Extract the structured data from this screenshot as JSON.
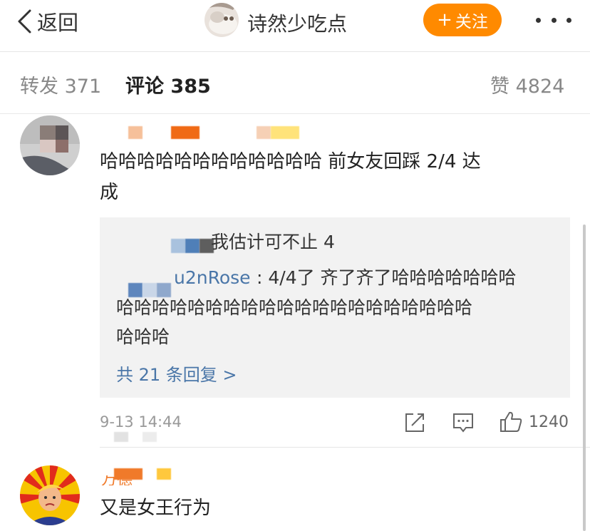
{
  "nav": {
    "back_label": "返回",
    "title": "诗然少吃点",
    "follow_label": "关注",
    "follow_plus": "+"
  },
  "tabs": {
    "repost_label": "转发",
    "repost_count": "371",
    "comment_label": "评论",
    "comment_count": "385",
    "like_label": "赞",
    "like_count": "4824"
  },
  "comments": [
    {
      "text_line1": "哈哈哈哈哈哈哈哈哈哈哈哈 前女友回踩 2/4  达",
      "text_line2": "成",
      "replies": {
        "reply1_text": "我估计可不止 4",
        "reply2_name_fragment": "u2nRose",
        "reply2_line1": ": 4/4了 齐了齐了哈哈哈哈哈哈哈",
        "reply2_line2": "哈哈哈哈哈哈哈哈哈哈哈哈哈哈哈哈哈哈哈哈",
        "reply2_line3": "哈哈哈",
        "more_label": "共 21 条回复 >"
      },
      "time": "9-13 14:44",
      "like_count": "1240"
    },
    {
      "username_fragment": "万德",
      "text": "又是女王行为"
    }
  ],
  "colors": {
    "accent_orange": "#ff8a00",
    "link_blue": "#4a76a8",
    "reply_bg": "#f2f2f2"
  },
  "icons": [
    "chevron-left-icon",
    "more-dots-icon",
    "share-icon",
    "comment-icon",
    "thumbs-up-icon"
  ]
}
